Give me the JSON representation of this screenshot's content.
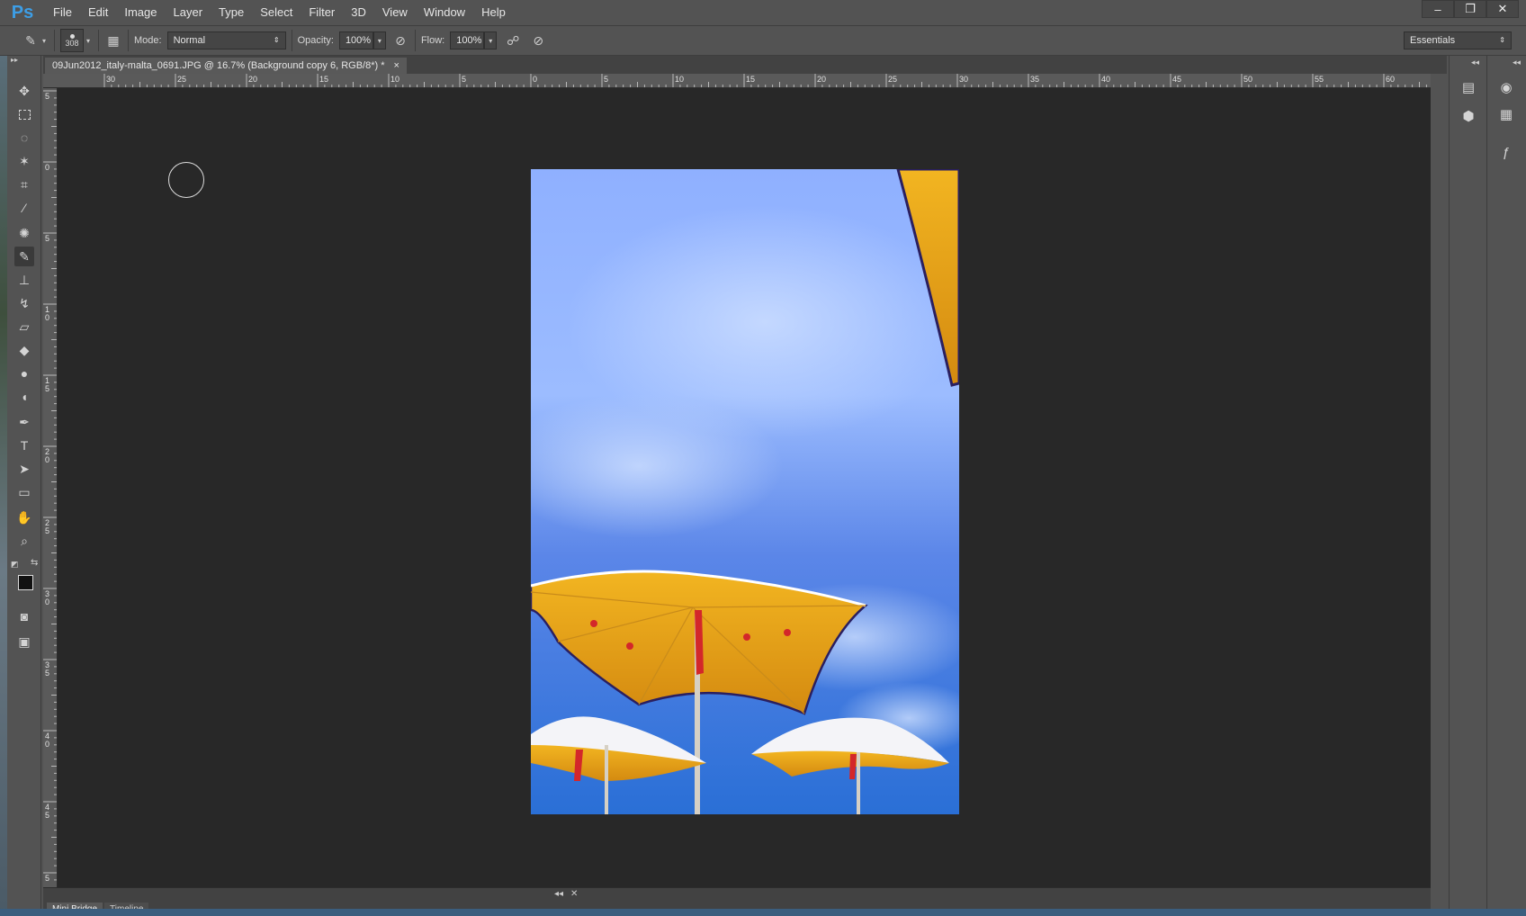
{
  "app": {
    "logo": "Ps"
  },
  "menu": [
    "File",
    "Edit",
    "Image",
    "Layer",
    "Type",
    "Select",
    "Filter",
    "3D",
    "View",
    "Window",
    "Help"
  ],
  "window_controls": {
    "minimize": "–",
    "restore": "❐",
    "close": "✕"
  },
  "options_bar": {
    "brush_size": "308",
    "mode_label": "Mode:",
    "mode_value": "Normal",
    "opacity_label": "Opacity:",
    "opacity_value": "100%",
    "flow_label": "Flow:",
    "flow_value": "100%",
    "workspace": "Essentials"
  },
  "document": {
    "tab_title": "09Jun2012_italy-malta_0691.JPG @ 16.7% (Background copy 6, RGB/8*) *",
    "tab_close": "×"
  },
  "ruler_h_labels": [
    "30",
    "25",
    "20",
    "15",
    "10",
    "5",
    "0",
    "5",
    "10",
    "15",
    "20",
    "25",
    "30",
    "35",
    "40",
    "45",
    "50",
    "55",
    "60"
  ],
  "ruler_v_labels": [
    "5",
    "0",
    "5",
    "10",
    "15",
    "20",
    "25",
    "30",
    "35",
    "40",
    "45",
    "5"
  ],
  "bottom_panel": {
    "tabs": [
      "Mini Bridge",
      "Timeline"
    ],
    "collapse": "◂◂",
    "close": "✕"
  },
  "colors": {
    "sky_top": "#8fb0ff",
    "sky_bottom": "#2a6fd6",
    "umbrella_yellow": "#e8a61a",
    "accent_red": "#d3272a"
  },
  "icons": {
    "tools": [
      "move-icon",
      "marquee-icon",
      "lasso-icon",
      "magic-wand-icon",
      "crop-icon",
      "eyedropper-icon",
      "healing-icon",
      "brush-icon",
      "stamp-icon",
      "history-brush-icon",
      "eraser-icon",
      "paint-bucket-icon",
      "blur-icon",
      "dodge-icon",
      "pen-icon",
      "type-icon",
      "path-select-icon",
      "rectangle-icon",
      "hand-icon",
      "zoom-icon"
    ]
  }
}
